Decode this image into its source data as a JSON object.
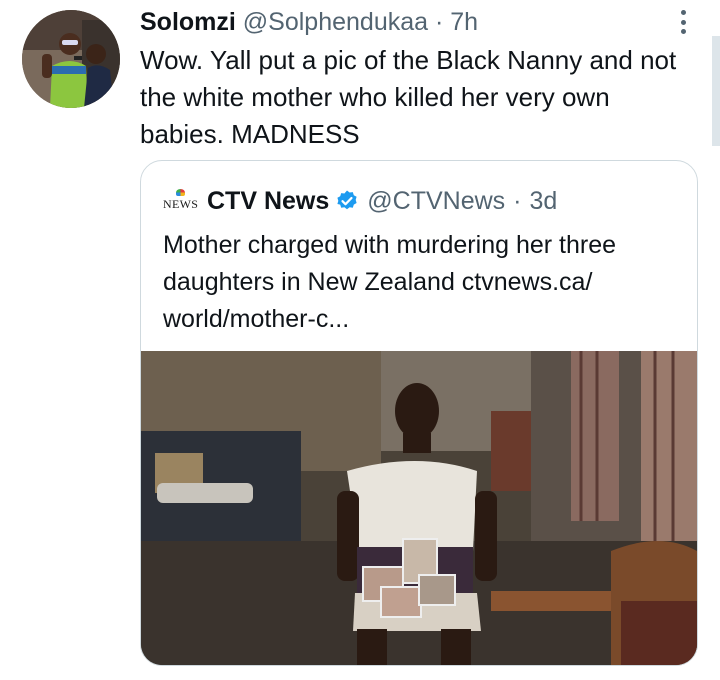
{
  "tweet": {
    "author_name": "Solomzi",
    "handle": "@Solphendukaa",
    "separator": "·",
    "time": "7h",
    "text": "Wow. Yall put a pic of the Black Nanny and not the white mother who killed her very own babies. MADNESS",
    "avatar_icon": "profile-photo",
    "more_icon": "more-vertical-icon"
  },
  "quoted": {
    "logo_text": "NEWS",
    "author_name": "CTV News",
    "verified_icon": "verified-badge-icon",
    "verified_color": "#1d9bf0",
    "handle": "@CTVNews",
    "separator": "·",
    "time": "3d",
    "text": "Mother charged with murdering her three daughters in New Zealand ctvnews.ca/ world/mother-c...",
    "photo_subject": "news-photo"
  }
}
